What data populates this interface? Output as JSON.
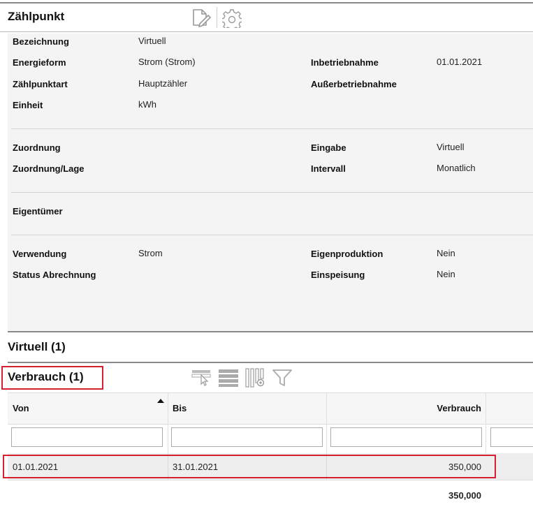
{
  "zaehlpunkt": {
    "title": "Zählpunkt",
    "fields_left": [
      {
        "label": "Bezeichnung",
        "value": "Virtuell"
      },
      {
        "label": "Energieform",
        "value": "Strom (Strom)"
      },
      {
        "label": "Zählpunktart",
        "value": "Hauptzähler"
      },
      {
        "label": "Einheit",
        "value": "kWh"
      }
    ],
    "fields_right": [
      {
        "label": "Inbetriebnahme",
        "value": "01.01.2021"
      },
      {
        "label": "Außerbetriebnahme",
        "value": ""
      }
    ],
    "zuordnung": [
      {
        "label": "Zuordnung",
        "value": ""
      },
      {
        "label": "Zuordnung/Lage",
        "value": ""
      }
    ],
    "eingabe": [
      {
        "label": "Eingabe",
        "value": "Virtuell"
      },
      {
        "label": "Intervall",
        "value": "Monatlich"
      }
    ],
    "eigentuemer": {
      "label": "Eigentümer",
      "value": ""
    },
    "verwendung": [
      {
        "label": "Verwendung",
        "value": "Strom"
      },
      {
        "label": "Status Abrechnung",
        "value": ""
      }
    ],
    "eigenproduktion": [
      {
        "label": "Eigenproduktion",
        "value": "Nein"
      },
      {
        "label": "Einspeisung",
        "value": "Nein"
      }
    ]
  },
  "virtuell_section": {
    "title": "Virtuell (1)"
  },
  "verbrauch_section": {
    "title": "Verbrauch (1)",
    "columns": [
      "Von",
      "Bis",
      "Verbrauch"
    ],
    "rows": [
      {
        "von": "01.01.2021",
        "bis": "31.01.2021",
        "verbrauch": "350,000"
      }
    ],
    "total": "350,000"
  },
  "icons": {
    "edit": "edit-document-icon",
    "settings": "gear-icon",
    "select": "select-row-icon",
    "rows": "rows-icon",
    "columns": "column-settings-icon",
    "filter": "filter-icon"
  }
}
